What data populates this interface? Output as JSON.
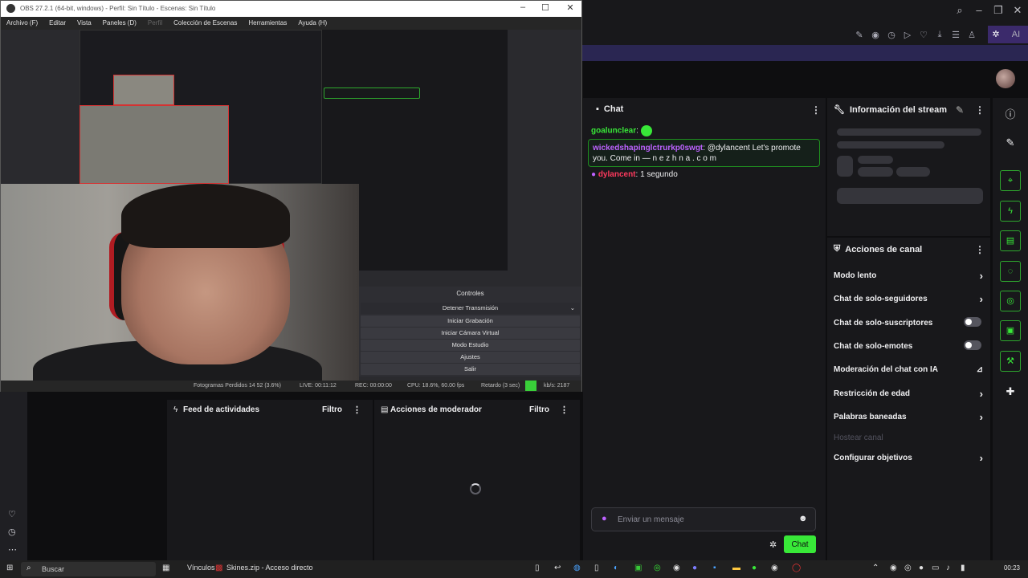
{
  "obs": {
    "title": "OBS 27.2.1 (64-bit, windows) - Perfil: Sin Título - Escenas: Sin Título",
    "menu": [
      "Archivo (F)",
      "Editar",
      "Vista",
      "Paneles (D)",
      "Perfil",
      "Colección de Escenas",
      "Herramientas",
      "Ayuda (H)"
    ],
    "controls_header": "Controles",
    "controls": [
      "Detener Transmisión",
      "Iniciar Grabación",
      "Iniciar Cámara Virtual",
      "Modo Estudio",
      "Ajustes",
      "Salir"
    ],
    "status": {
      "dropped": "Fotogramas Perdidos 14 52 (3.6%)",
      "live": "LIVE: 00:11:12",
      "rec": "REC: 00:00:00",
      "cpu": "CPU: 18.6%, 60.00 fps",
      "delay": "Retardo (3 sec)",
      "kbps": "kb/s: 2187"
    }
  },
  "chat": {
    "title": "Chat",
    "messages": [
      {
        "user": "goalunclear",
        "text": ""
      },
      {
        "user": "wickedshapinglctrurkp0swgt",
        "text": "@dylancent Let's promote  you. Come in — n e z h n a . c o m"
      },
      {
        "user": "dylancent",
        "text": ": 1 segundo"
      }
    ],
    "input_placeholder": "Enviar un mensaje",
    "send_label": "Chat"
  },
  "stream_info": {
    "title": "Información del stream"
  },
  "channel_actions": {
    "title": "Acciones de canal",
    "items": [
      {
        "label": "Modo lento",
        "kind": "chevron"
      },
      {
        "label": "Chat de solo-seguidores",
        "kind": "chevron"
      },
      {
        "label": "Chat de solo-suscriptores",
        "kind": "toggle"
      },
      {
        "label": "Chat de solo-emotes",
        "kind": "toggle"
      },
      {
        "label": "Moderación del chat con IA",
        "kind": "chart"
      },
      {
        "label": "Restricción de edad",
        "kind": "chevron"
      },
      {
        "label": "Palabras baneadas",
        "kind": "chevron"
      },
      {
        "label": "Hostear canal",
        "kind": "disabled"
      },
      {
        "label": "Configurar objetivos",
        "kind": "chevron"
      }
    ]
  },
  "feed": {
    "title": "Feed de actividades",
    "filter": "Filtro"
  },
  "mod_actions": {
    "title": "Acciones de moderador",
    "filter": "Filtro"
  },
  "toolbar": {
    "ai_label": "AI"
  },
  "taskbar": {
    "search_placeholder": "Buscar",
    "links_label": "Vínculos",
    "shortcut_label": "Skines.zip - Acceso directo",
    "clock": "00:23"
  },
  "colors": {
    "accent_green": "#38e838",
    "twitch_purple": "#9147ff",
    "obs_red": "#d43333"
  }
}
